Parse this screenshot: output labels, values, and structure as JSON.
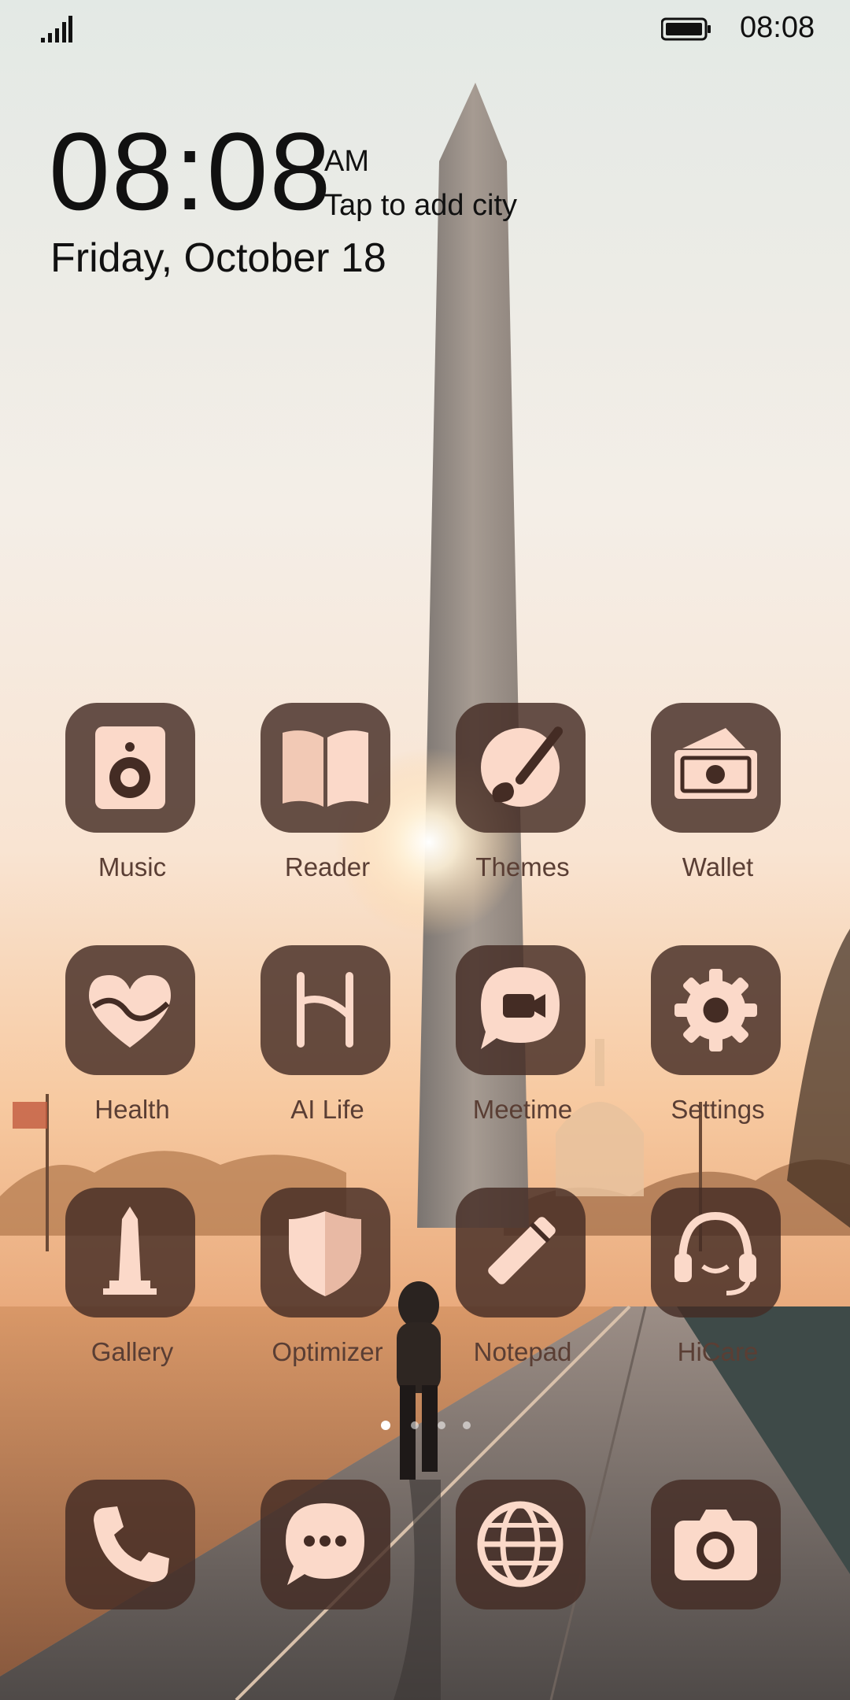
{
  "status_bar": {
    "time": "08:08",
    "signal_icon": "signal-icon",
    "battery_icon": "battery-icon"
  },
  "clock": {
    "time": "08:08",
    "ampm": "AM",
    "city": "Tap to add city",
    "date": "Friday, October 18"
  },
  "colors": {
    "tile": "#442c24",
    "glyph": "#fbd9c9",
    "label": "#5a3e34"
  },
  "apps": [
    {
      "label": "Music",
      "icon": "speaker-icon"
    },
    {
      "label": "Reader",
      "icon": "book-icon"
    },
    {
      "label": "Themes",
      "icon": "paintbrush-icon"
    },
    {
      "label": "Wallet",
      "icon": "wallet-icon"
    },
    {
      "label": "Health",
      "icon": "heart-icon"
    },
    {
      "label": "AI Life",
      "icon": "ai-life-icon"
    },
    {
      "label": "Meetime",
      "icon": "video-chat-icon"
    },
    {
      "label": "Settings",
      "icon": "gear-icon"
    },
    {
      "label": "Gallery",
      "icon": "monument-icon"
    },
    {
      "label": "Optimizer",
      "icon": "shield-icon"
    },
    {
      "label": "Notepad",
      "icon": "pencil-icon"
    },
    {
      "label": "HiCare",
      "icon": "headset-icon"
    }
  ],
  "page_indicator": {
    "pages": 4,
    "current": 1
  },
  "dock": [
    {
      "icon": "phone-icon"
    },
    {
      "icon": "messages-icon"
    },
    {
      "icon": "globe-icon"
    },
    {
      "icon": "camera-icon"
    }
  ]
}
